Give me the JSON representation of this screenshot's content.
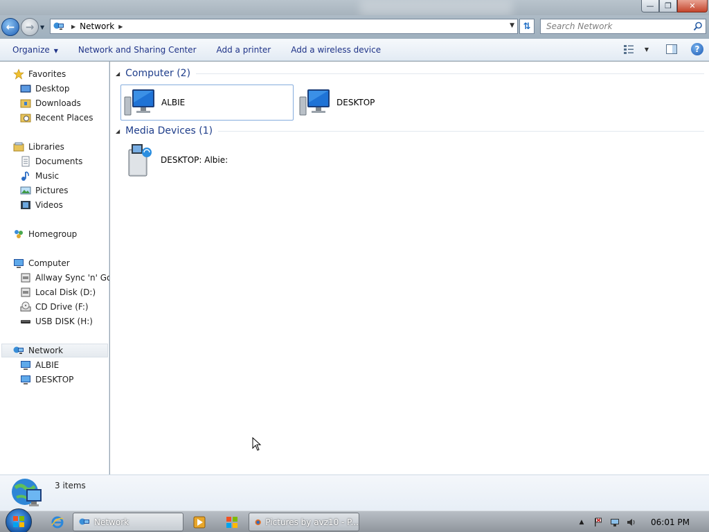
{
  "window": {
    "buttons": {
      "minimize": "—",
      "maximize": "❐",
      "close": "✕"
    }
  },
  "address": {
    "crumbs": [
      "Network"
    ],
    "search_placeholder": "Search Network"
  },
  "commands": {
    "organize": "Organize",
    "network_sharing": "Network and Sharing Center",
    "add_printer": "Add a printer",
    "add_wireless": "Add a wireless device"
  },
  "navpane": {
    "favorites": {
      "label": "Favorites",
      "items": [
        "Desktop",
        "Downloads",
        "Recent Places"
      ]
    },
    "libraries": {
      "label": "Libraries",
      "items": [
        "Documents",
        "Music",
        "Pictures",
        "Videos"
      ]
    },
    "homegroup": "Homegroup",
    "computer": {
      "label": "Computer",
      "items": [
        "Allway Sync 'n' Go (",
        "Local Disk (D:)",
        "CD Drive (F:)",
        "USB DISK (H:)"
      ]
    },
    "network": {
      "label": "Network",
      "items": [
        "ALBIE",
        "DESKTOP"
      ]
    }
  },
  "content": {
    "groups": [
      {
        "title": "Computer (2)",
        "items": [
          "ALBIE",
          "DESKTOP"
        ]
      },
      {
        "title": "Media Devices (1)",
        "items": [
          "DESKTOP: Albie:"
        ]
      }
    ]
  },
  "details": {
    "count": "3 items"
  },
  "taskbar": {
    "tasks": [
      "Network",
      "Pictures by avz10 - P..."
    ],
    "clock": "06:01 PM"
  },
  "colors": {
    "accent": "#1e3d8a",
    "link": "#1e3287",
    "selection_border": "#84acdd"
  }
}
